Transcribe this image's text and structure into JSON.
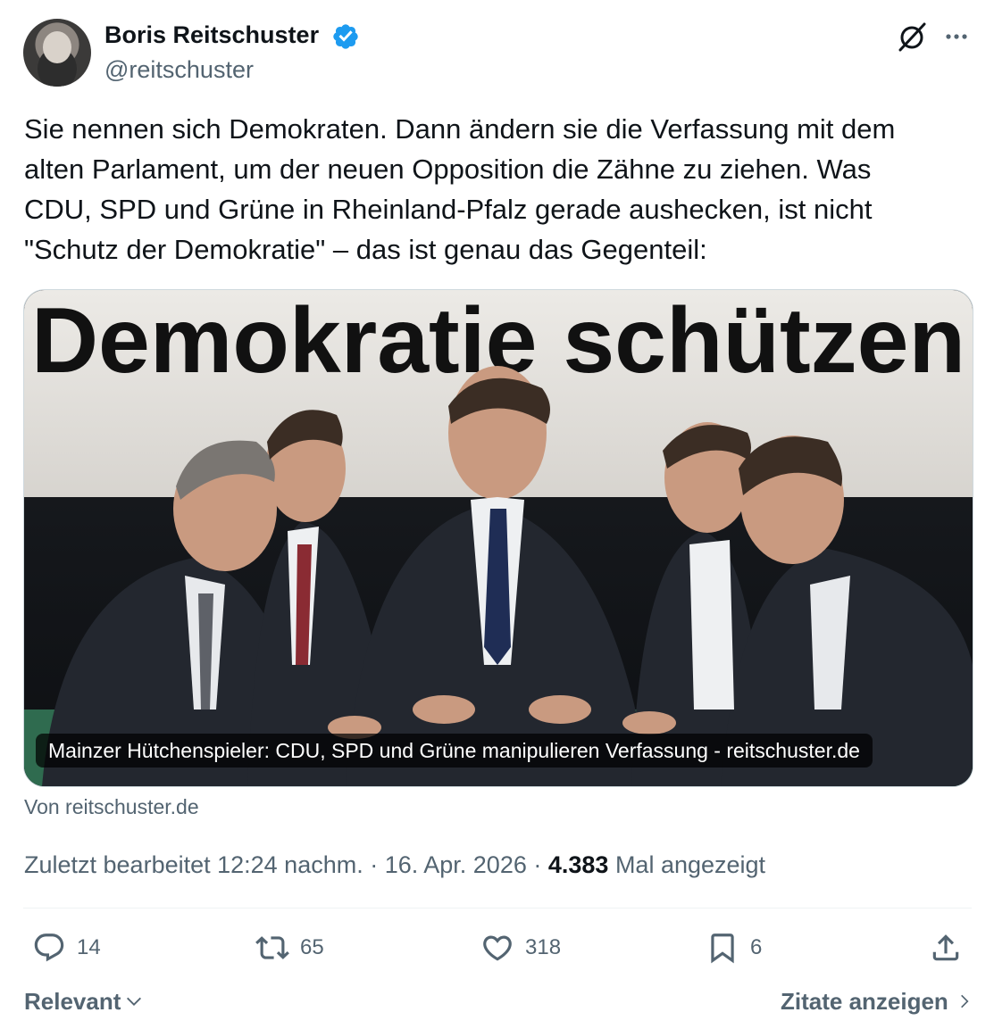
{
  "author": {
    "name": "Boris Reitschuster",
    "handle": "@reitschuster",
    "verified_color": "#1d9bf0"
  },
  "header_icons": [
    "grok-icon",
    "more-icon"
  ],
  "tweet": {
    "text": "Sie nennen sich Demokraten. Dann ändern sie die Verfassung mit dem\nalten Parlament, um der neuen Opposition die Zähne zu ziehen. Was\nCDU, SPD und Grüne in Rheinland-Pfalz gerade aushecken, ist nicht\n\"Schutz der Demokratie\" – das ist genau das Gegenteil:"
  },
  "card": {
    "banner_text": "Demokratie schützen",
    "caption": "Mainzer Hütchenspieler: CDU, SPD und Grüne manipulieren Verfassung - reitschuster.de",
    "source": "Von reitschuster.de"
  },
  "meta": {
    "edited": "Zuletzt bearbeitet 12:24 nachm. · 16. Apr. 2026 · ",
    "views": "4.383",
    "views_suffix": " Mal angezeigt"
  },
  "actions": {
    "replies": "14",
    "reposts": "65",
    "likes": "318",
    "bookmarks": "6"
  },
  "footer": {
    "sort_label": "Relevant",
    "quotes_label": "Zitate anzeigen"
  },
  "colors": {
    "text": "#0f1419",
    "secondary": "#536471",
    "accent": "#1d9bf0"
  }
}
